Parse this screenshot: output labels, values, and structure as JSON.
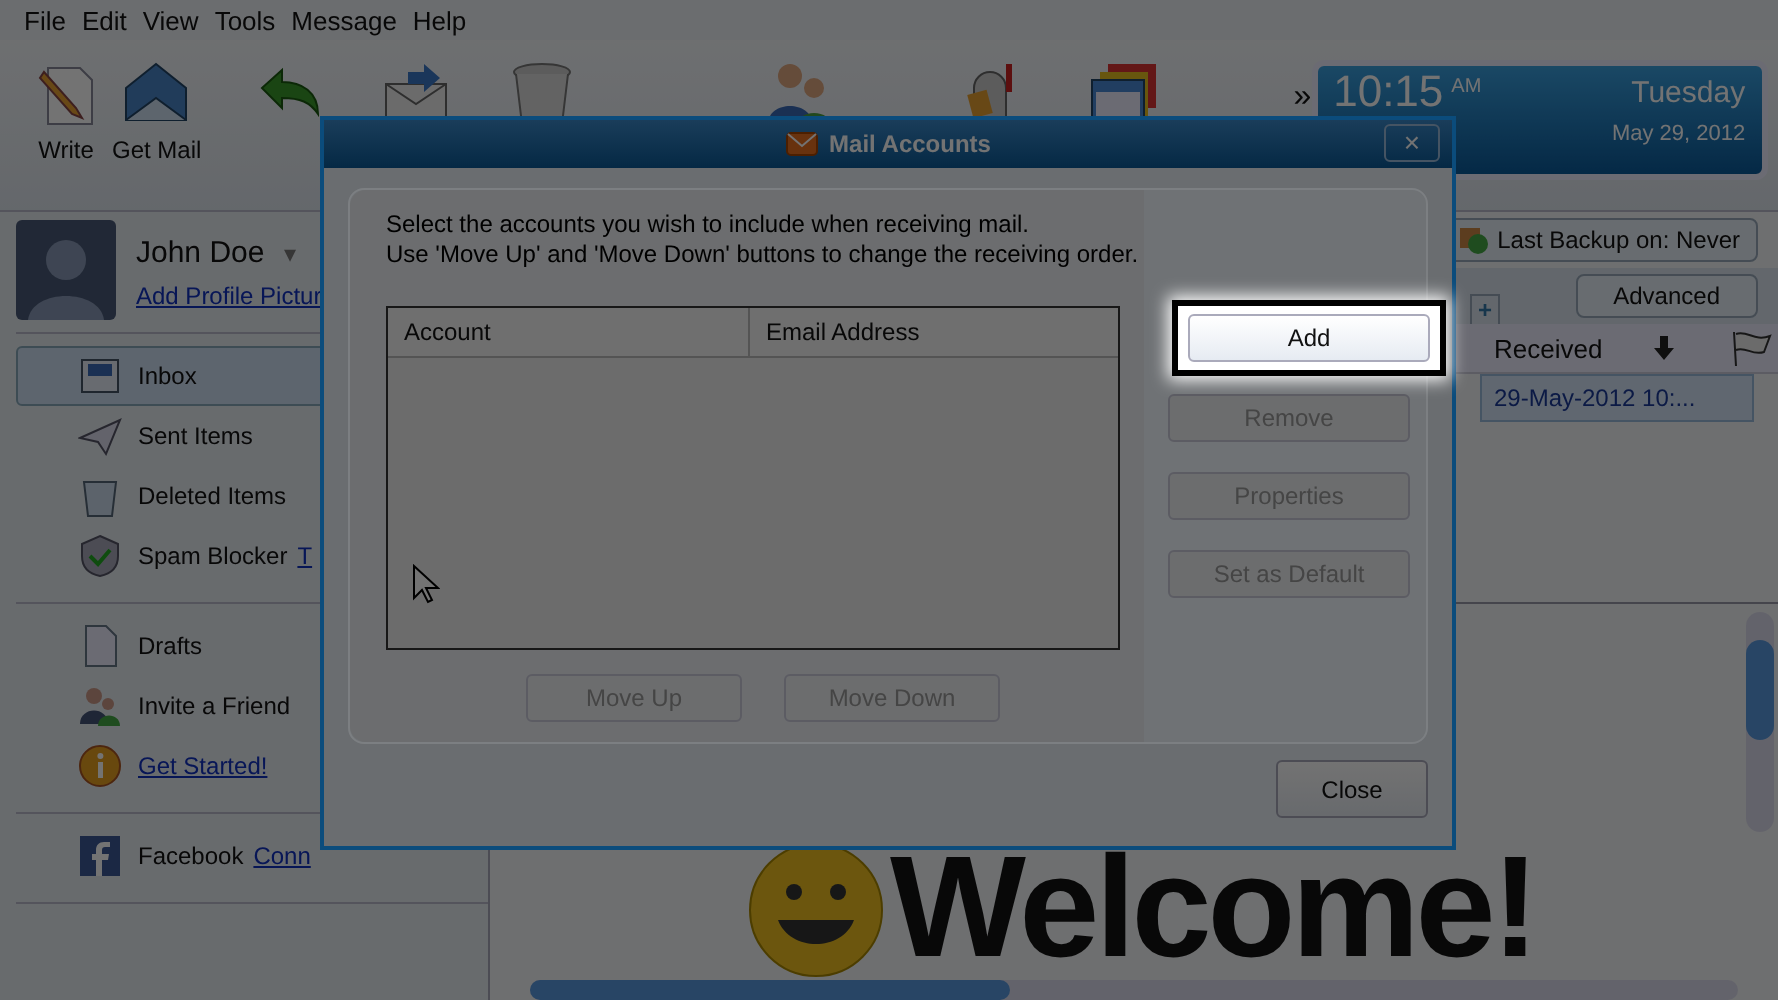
{
  "menu": [
    "File",
    "Edit",
    "View",
    "Tools",
    "Message",
    "Help"
  ],
  "toolbar": {
    "buttons": [
      {
        "label": "Write"
      },
      {
        "label": "Get Mail"
      }
    ],
    "overflow": "»"
  },
  "clock": {
    "time": "10:15",
    "ampm": "AM",
    "day": "Tuesday",
    "date": "May 29, 2012"
  },
  "profile": {
    "name": "John Doe",
    "caret": "▾",
    "link": "Add Profile Pictur"
  },
  "sidebar": {
    "groups": [
      [
        {
          "label": "Inbox",
          "selected": true,
          "kind": "item"
        },
        {
          "label": "Sent Items",
          "selected": false,
          "kind": "item"
        },
        {
          "label": "Deleted Items",
          "selected": false,
          "kind": "item"
        },
        {
          "label": "Spam Blocker",
          "selected": false,
          "kind": "item",
          "link": "T"
        }
      ],
      [
        {
          "label": "Drafts",
          "selected": false,
          "kind": "item"
        },
        {
          "label": "Invite a Friend",
          "selected": false,
          "kind": "item"
        },
        {
          "label": "Get Started!",
          "selected": false,
          "kind": "link"
        }
      ],
      [
        {
          "label": "Facebook",
          "selected": false,
          "kind": "item",
          "link": "Conn"
        }
      ]
    ]
  },
  "backup": "Last Backup on:  Never",
  "advanced": "Advanced",
  "add_tab": "+",
  "message_list": {
    "columns": [
      "Received"
    ],
    "rows": [
      {
        "received": "29-May-2012 10:...",
        "selected": true
      }
    ]
  },
  "preview": {
    "heading": "Welcome!"
  },
  "dialog": {
    "title": "Mail Accounts",
    "close_icon": "×",
    "instructions": [
      "Select the accounts you wish to include when receiving mail.",
      "Use 'Move Up' and 'Move Down' buttons to change the receiving order."
    ],
    "columns": [
      "Account",
      "Email Address"
    ],
    "side_buttons": [
      {
        "label": "Add",
        "disabled": false,
        "focused": true
      },
      {
        "label": "Remove",
        "disabled": true,
        "focused": false
      },
      {
        "label": "Properties",
        "disabled": true,
        "focused": false
      },
      {
        "label": "Set as Default",
        "disabled": true,
        "focused": false
      }
    ],
    "bottom_buttons": [
      {
        "label": "Move Up",
        "disabled": true
      },
      {
        "label": "Move Down",
        "disabled": true
      }
    ],
    "close": "Close"
  }
}
